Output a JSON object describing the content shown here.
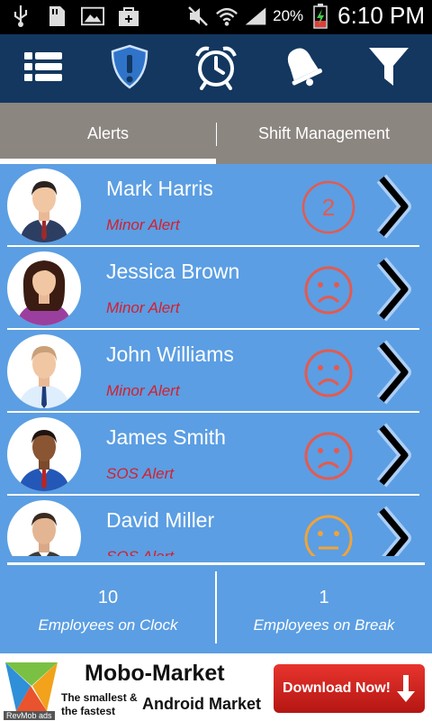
{
  "status_bar": {
    "battery": "20%",
    "time": "6:10 PM"
  },
  "tabs": [
    {
      "label": "Alerts",
      "active": true
    },
    {
      "label": "Shift Management",
      "active": false
    }
  ],
  "employees": [
    {
      "name": "Mark Harris",
      "alert": "Minor Alert",
      "status": "count",
      "count": "2"
    },
    {
      "name": "Jessica Brown",
      "alert": "Minor Alert",
      "status": "sad"
    },
    {
      "name": "John Williams",
      "alert": "Minor Alert",
      "status": "sad"
    },
    {
      "name": "James Smith",
      "alert": "SOS Alert",
      "status": "sad"
    },
    {
      "name": "David Miller",
      "alert": "SOS Alert",
      "status": "neutral"
    }
  ],
  "stats": {
    "on_clock": {
      "value": "10",
      "label": "Employees on Clock"
    },
    "on_break": {
      "value": "1",
      "label": "Employees on Break"
    }
  },
  "ad": {
    "brand": "Mobo-Market",
    "tagline_1": "The smallest &",
    "tagline_2": "the fastest",
    "market": "Android Market",
    "cta": "Download Now!",
    "source": "RevMob ads"
  },
  "colors": {
    "background": "#5b9ee3",
    "toolbar": "#13375f",
    "tabs": "#8c8680",
    "alert_text": "#d4202e",
    "sad_face": "#e45a4f",
    "neutral_face": "#f0a33a"
  },
  "icons": {
    "toolbar": [
      "list-icon",
      "shield-alert-icon",
      "alarm-clock-icon",
      "bell-icon",
      "filter-icon"
    ]
  }
}
